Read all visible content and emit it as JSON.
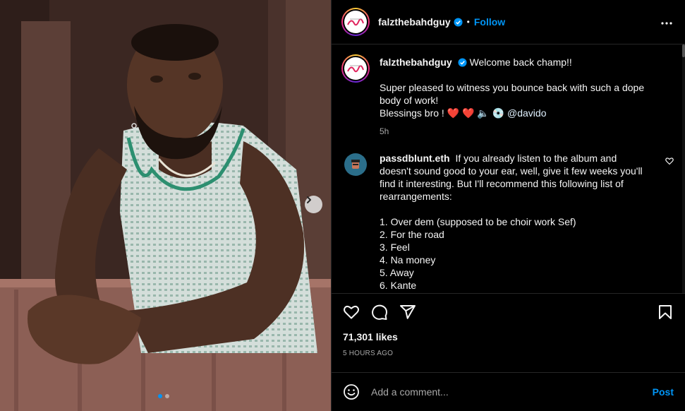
{
  "post": {
    "author": "falzthebahdguy",
    "verified": true,
    "follow_label": "Follow",
    "bullet": "•",
    "photo_dots": {
      "count": 2,
      "active": 1
    }
  },
  "icons": {
    "more": "more-options-icon",
    "next": "chevron-right-icon",
    "like": "heart-icon",
    "comment": "comment-bubble-icon",
    "share": "paper-plane-icon",
    "save": "bookmark-icon",
    "emoji": "smiley-icon",
    "verified": "verified-badge-icon",
    "comment_like": "small-heart-icon"
  },
  "caption": {
    "username": "falzthebahdguy",
    "line1": "Welcome back champ!!",
    "line2": "Super pleased to witness you bounce back with such a dope body of work!",
    "line3_prefix": "Blessings bro ! ",
    "emojis": "❤️ ❤️ 🔈 💿",
    "mention": "@davido",
    "time": "5h"
  },
  "comment1": {
    "username": "passdblunt.eth",
    "text": "If you already listen to the album and doesn't sound good to your ear, well, give it few weeks you'll find it interesting. But I'll recommend this following list of rearrangements:",
    "list": [
      "1. Over dem (supposed to be choir work Sef)",
      "2. For the road",
      "3. Feel",
      "4. Na money",
      "5. Away",
      "6. Kante"
    ]
  },
  "stats": {
    "likes": "71,301 likes",
    "ago": "5 HOURS AGO"
  },
  "composer": {
    "placeholder": "Add a comment...",
    "post_label": "Post"
  },
  "colors": {
    "accent": "#0095f6",
    "background": "#000000",
    "text": "#f5f5f5",
    "muted": "#a8a8a8",
    "divider": "#262626",
    "heart": "#ed4956"
  }
}
